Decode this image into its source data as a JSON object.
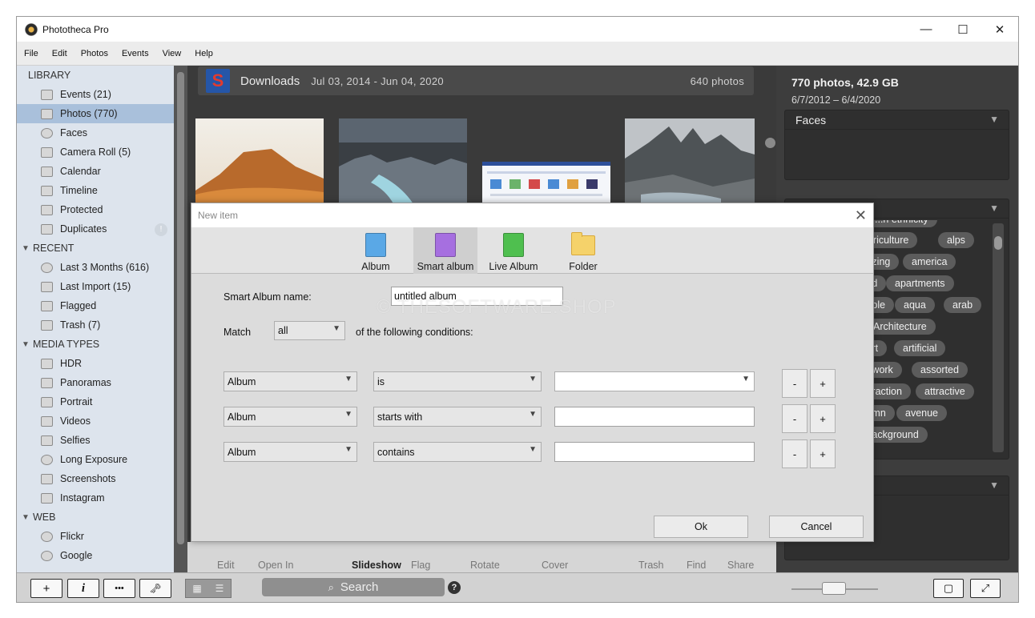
{
  "app": {
    "title": "Phototheca Pro",
    "minimize": "—",
    "maximize": "☐",
    "close": "✕"
  },
  "menu": [
    "File",
    "Edit",
    "Photos",
    "Events",
    "View",
    "Help"
  ],
  "sidebar": {
    "library_header": "LIBRARY",
    "library": [
      {
        "label": "Events (21)",
        "icon": "events-icon"
      },
      {
        "label": "Photos (770)",
        "icon": "photos-icon",
        "selected": true
      },
      {
        "label": "Faces",
        "icon": "faces-icon"
      },
      {
        "label": "Camera Roll (5)",
        "icon": "camera-roll-icon"
      },
      {
        "label": "Calendar",
        "icon": "calendar-icon"
      },
      {
        "label": "Timeline",
        "icon": "timeline-icon"
      },
      {
        "label": "Protected",
        "icon": "protected-icon"
      },
      {
        "label": "Duplicates",
        "icon": "duplicates-icon"
      }
    ],
    "recent_header": "RECENT",
    "recent": [
      {
        "label": "Last 3 Months (616)",
        "icon": "clock-icon"
      },
      {
        "label": "Last Import (15)",
        "icon": "import-icon"
      },
      {
        "label": "Flagged",
        "icon": "flag-icon"
      },
      {
        "label": "Trash (7)",
        "icon": "trash-icon"
      }
    ],
    "media_header": "MEDIA TYPES",
    "media": [
      {
        "label": "HDR",
        "icon": "hdr-icon"
      },
      {
        "label": "Panoramas",
        "icon": "panorama-icon"
      },
      {
        "label": "Portrait",
        "icon": "portrait-icon"
      },
      {
        "label": "Videos",
        "icon": "video-icon"
      },
      {
        "label": "Selfies",
        "icon": "selfie-icon"
      },
      {
        "label": "Long Exposure",
        "icon": "long-exposure-icon"
      },
      {
        "label": "Screenshots",
        "icon": "screenshot-icon"
      },
      {
        "label": "Instagram",
        "icon": "instagram-icon"
      }
    ],
    "web_header": "WEB",
    "web": [
      {
        "label": "Flickr",
        "icon": "flickr-icon"
      },
      {
        "label": "Google",
        "icon": "google-icon"
      }
    ]
  },
  "center": {
    "folder_name": "Downloads",
    "date_range": "Jul 03, 2014 - Jun 04, 2020",
    "photo_count": "640 photos",
    "toolbar": [
      "Edit",
      "Open In",
      "Slideshow",
      "Flag",
      "Rotate",
      "Cover",
      "Trash",
      "Find",
      "Share"
    ]
  },
  "right": {
    "summary": "770 photos, 42.9 GB",
    "dates": "6/7/2012 – 6/4/2020",
    "faces_header": "Faces",
    "tags": [
      "...n ethnicity",
      "agriculture",
      "alps",
      "...zing",
      "america",
      "...d",
      "apartments",
      "...ple",
      "aqua",
      "arab",
      "Architecture",
      "...rt",
      "artificial",
      "...work",
      "assorted",
      "...raction",
      "attractive",
      "...mn",
      "avenue",
      "...ackground"
    ]
  },
  "bottombar": {
    "add": "+",
    "info": "i",
    "more": "•••",
    "key": "🔑",
    "search_placeholder": "Search",
    "help": "?"
  },
  "dialog": {
    "title": "New item",
    "close": "✕",
    "types": [
      {
        "label": "Album",
        "color": "#5aa8e6"
      },
      {
        "label": "Smart album",
        "color": "#a66fe0",
        "selected": true
      },
      {
        "label": "Live Album",
        "color": "#4fbf4f"
      },
      {
        "label": "Folder",
        "color": "#f5d26a"
      }
    ],
    "name_label": "Smart Album name:",
    "name_value": "untitled album",
    "match_label": "Match",
    "match_value": "all",
    "match_suffix": "of the following conditions:",
    "conditions": [
      {
        "field": "Album",
        "operator": "is",
        "value": ""
      },
      {
        "field": "Album",
        "operator": "starts with",
        "value": ""
      },
      {
        "field": "Album",
        "operator": "contains",
        "value": ""
      }
    ],
    "minus": "-",
    "plus": "+",
    "ok": "Ok",
    "cancel": "Cancel"
  },
  "watermark": "© THESOFTWARE.SHOP"
}
